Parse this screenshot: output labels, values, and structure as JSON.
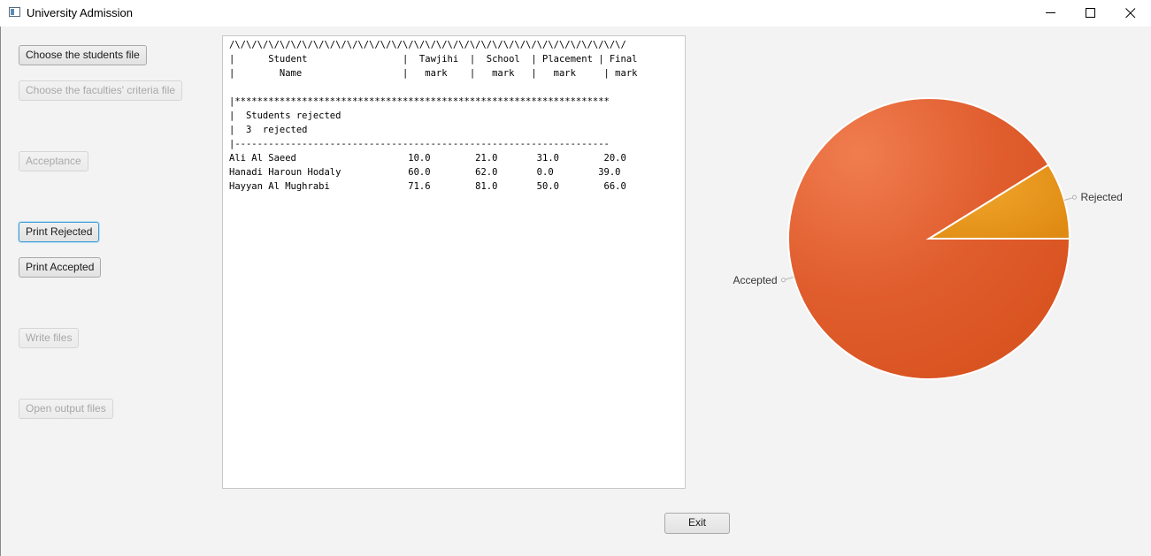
{
  "window": {
    "title": "University Admission",
    "controls": [
      "minimize-icon",
      "maximize-icon",
      "close-icon"
    ]
  },
  "buttons": {
    "choose_students": "Choose the students file",
    "choose_faculties": "Choose the faculties' criteria file",
    "acceptance": "Acceptance",
    "print_rejected": "Print Rejected",
    "print_accepted": "Print Accepted",
    "write_files": "Write files",
    "open_output": "Open output files",
    "exit": "Exit"
  },
  "output": {
    "lines": [
      "/\\/\\/\\/\\/\\/\\/\\/\\/\\/\\/\\/\\/\\/\\/\\/\\/\\/\\/\\/\\/\\/\\/\\/\\/\\/\\/\\/\\/\\/\\/\\/\\/\\/\\/\\/",
      "|      Student                 |  Tawjihi  |  School  | Placement | Final",
      "|        Name                  |   mark    |   mark   |   mark     | mark",
      "",
      "|*******************************************************************",
      "|  Students rejected",
      "|  3  rejected",
      "|-------------------------------------------------------------------",
      "Ali Al Saeed                    10.0        21.0       31.0        20.0",
      "Hanadi Haroun Hodaly            60.0        62.0       0.0        39.0",
      "Hayyan Al Mughrabi              71.6        81.0       50.0        66.0"
    ]
  },
  "chart_data": {
    "type": "pie",
    "labels": [
      "Rejected",
      "Accepted"
    ],
    "values": [
      3,
      31
    ],
    "colors": [
      "#e6961e",
      "#e05a2a"
    ]
  }
}
